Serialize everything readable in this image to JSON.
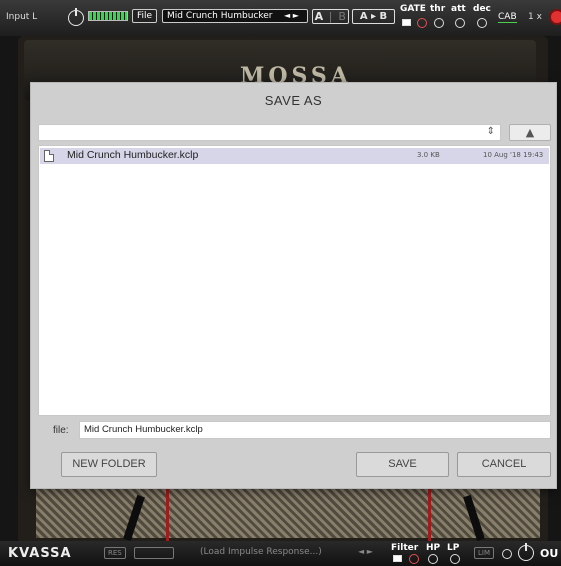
{
  "toolbar": {
    "input_label": "Input L",
    "file_button": "File",
    "preset_name": "Mid Crunch Humbucker",
    "preset_arrows": "◄ ►",
    "ab_a": "A",
    "ab_sep": "|",
    "ab_b": "B",
    "ab_copy": "A ▸ B",
    "gate_label": "GATE",
    "thr_label": "thr",
    "att_label": "att",
    "dec_label": "dec",
    "cab_label": "CAB",
    "oversample": "1 x",
    "meter_color": "#37d64c",
    "power_color": "#e03030"
  },
  "amp": {
    "brand": "MOSSA"
  },
  "dialog": {
    "title": "SAVE AS",
    "path_value": "",
    "up_button_icon": "up-arrow-icon",
    "files": [
      {
        "name": "Mid Crunch Humbucker.kclp",
        "size": "3.0 KB",
        "date": "10 Aug '18 19:43",
        "selected": true
      }
    ],
    "file_label": "file:",
    "file_value": "Mid Crunch Humbucker.kclp",
    "new_folder_button": "NEW FOLDER",
    "save_button": "SAVE",
    "cancel_button": "CANCEL",
    "selection_color": "#d6d6e8"
  },
  "bottombar": {
    "logo": "KVASSA",
    "res_label": "RES",
    "ir_placeholder": "(Load Impulse Response...)",
    "ir_arrows": "◄ ►",
    "filter_label": "Filter",
    "hp_label": "HP",
    "lp_label": "LP",
    "lim_label": "LIM",
    "out_label": "OU"
  }
}
